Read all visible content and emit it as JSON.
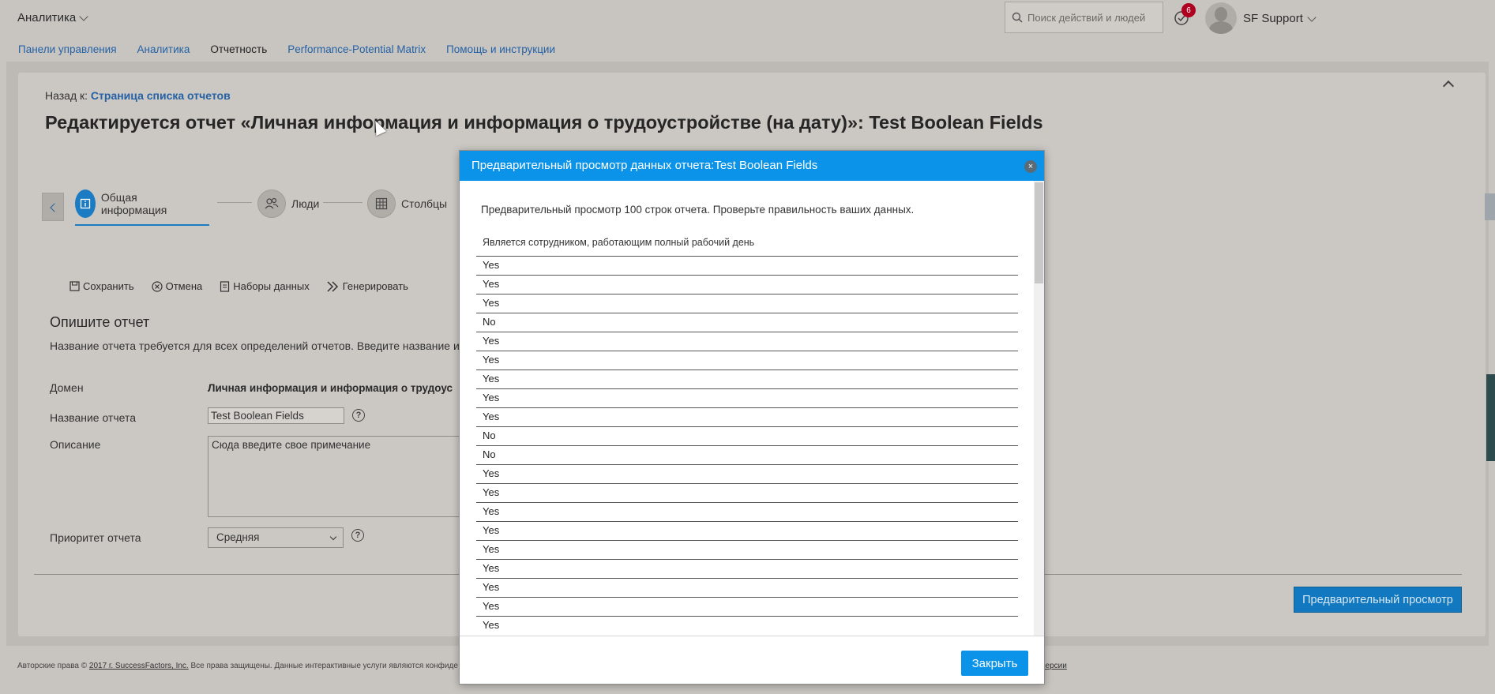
{
  "topbar": {
    "app_menu": "Аналитика",
    "search_placeholder": "Поиск действий и людей",
    "notification_count": "6",
    "user_name": "SF Support"
  },
  "nav": {
    "items": [
      "Панели управления",
      "Аналитика",
      "Отчетность",
      "Performance-Potential Matrix",
      "Помощь и инструкции"
    ],
    "active": "Отчетность"
  },
  "page": {
    "back_prefix": "Назад к:",
    "back_link": "Страница списка отчетов",
    "title": "Редактируется отчет «Личная информация и информация о трудоустройстве (на дату)»: Test Boolean Fields"
  },
  "steps": [
    "Общая информация",
    "Люди",
    "Столбцы"
  ],
  "toolbar": {
    "save": "Сохранить",
    "cancel": "Отмена",
    "datasets": "Наборы данных",
    "generate": "Генерировать"
  },
  "form": {
    "section_title": "Опишите отчет",
    "section_desc": "Название отчета требуется для всех определений отчетов. Введите название и",
    "domain_label": "Домен",
    "domain_value": "Личная информация и информация о трудоус",
    "name_label": "Название отчета",
    "name_value": "Test Boolean Fields",
    "description_label": "Описание",
    "description_placeholder": "Сюда введите свое примечание",
    "priority_label": "Приоритет отчета",
    "priority_value": "Средняя",
    "help": "?"
  },
  "preview_button": "Предварительный просмотр",
  "footer": {
    "prefix": "Авторские права ©",
    "link": "2017 г. SuccessFactors, Inc.",
    "rest": "Все права защищены. Данные интерактивные услуги являются конфиде",
    "right": "о версии"
  },
  "modal": {
    "title": "Предварительный просмотр данных отчета:Test Boolean Fields",
    "info": "Предварительный просмотр 100 строк отчета. Проверьте правильность ваших данных.",
    "column_header": "Является сотрудником, работающим полный рабочий день",
    "rows": [
      "Yes",
      "Yes",
      "Yes",
      "No",
      "Yes",
      "Yes",
      "Yes",
      "Yes",
      "Yes",
      "No",
      "No",
      "Yes",
      "Yes",
      "Yes",
      "Yes",
      "Yes",
      "Yes",
      "Yes",
      "Yes",
      "Yes"
    ],
    "close_button": "Закрыть",
    "close_icon": "×"
  }
}
